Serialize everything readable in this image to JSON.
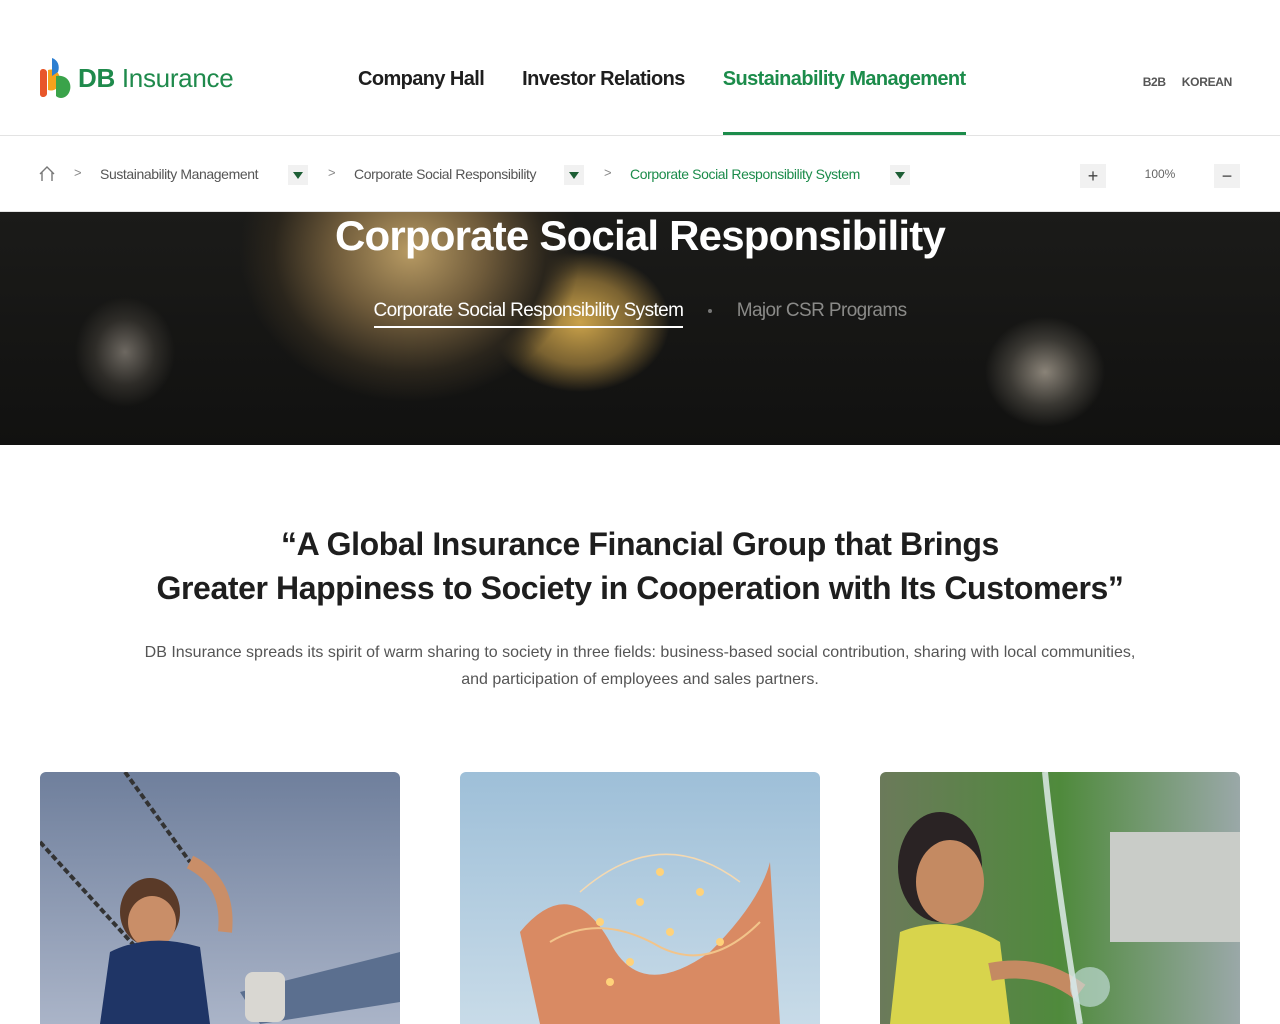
{
  "brand": {
    "name_bold": "DB",
    "name_rest": " Insurance"
  },
  "nav": {
    "items": [
      {
        "label": "Company Hall"
      },
      {
        "label": "Investor Relations"
      },
      {
        "label": "Sustainability Management"
      }
    ],
    "active_index": 2
  },
  "util": {
    "b2b": "B2B",
    "language": "KOREAN"
  },
  "breadcrumb": {
    "home_icon": "home-icon",
    "items": [
      {
        "label": "Sustainability Management"
      },
      {
        "label": "Corporate Social Responsibility"
      },
      {
        "label": "Corporate Social Responsibility System"
      }
    ],
    "separator": ">",
    "zoom": {
      "plus": "+",
      "value": "100%",
      "minus": "−"
    }
  },
  "hero": {
    "title": "Corporate Social Responsibility",
    "tabs": [
      {
        "label": "Corporate Social Responsibility System",
        "active": true
      },
      {
        "label": "Major CSR Programs",
        "active": false
      }
    ]
  },
  "intro": {
    "quote_line1": "“A Global Insurance Financial Group that Brings",
    "quote_line2": "Greater Happiness to Society in Cooperation with Its Customers”",
    "description_line1": "DB Insurance spreads its spirit of warm sharing to society in three fields: business-based social contribution, sharing with local communities,",
    "description_line2": "and participation of employees and sales partners."
  },
  "colors": {
    "accent": "#1c8c4b",
    "text": "#1e1e1e",
    "muted": "#555555"
  }
}
